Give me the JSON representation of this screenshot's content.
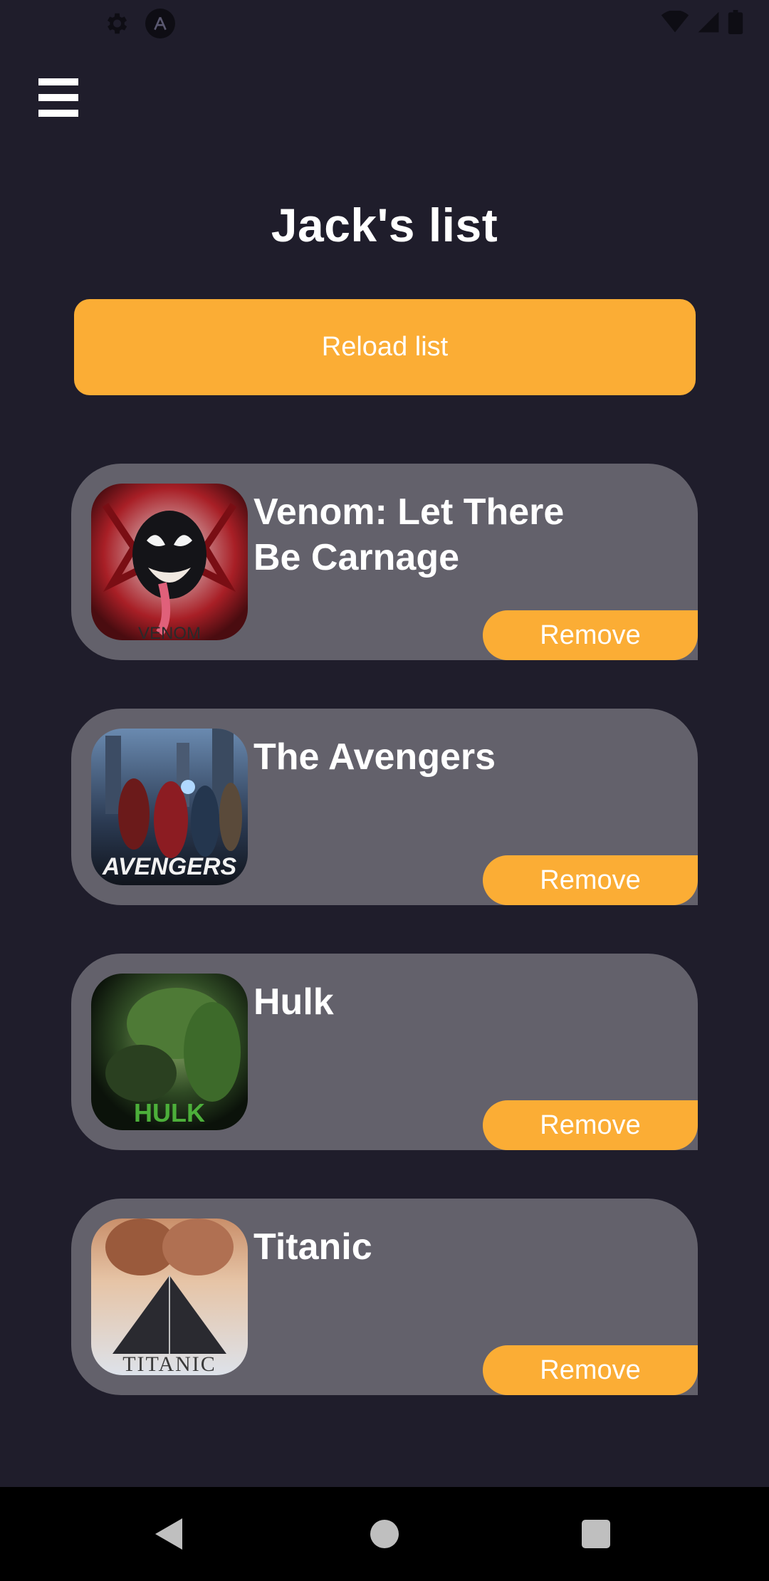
{
  "status_bar": {
    "left_icons": [
      "gear-icon",
      "auto-a-icon"
    ],
    "right_icons": [
      "wifi-icon",
      "cellular-signal-icon",
      "battery-icon"
    ]
  },
  "header": {
    "menu_icon": "hamburger-menu-icon",
    "title": "Jack's list"
  },
  "actions": {
    "reload_label": "Reload list"
  },
  "movies": [
    {
      "title": "Venom: Let There Be Carnage",
      "poster_text": "VENOM",
      "remove_label": "Remove"
    },
    {
      "title": "The Avengers",
      "poster_text": "AVENGERS",
      "remove_label": "Remove"
    },
    {
      "title": "Hulk",
      "poster_text": "HULK",
      "remove_label": "Remove"
    },
    {
      "title": "Titanic",
      "poster_text": "TITANIC",
      "remove_label": "Remove"
    }
  ],
  "nav_bar": {
    "buttons": [
      "back-icon",
      "home-icon",
      "recents-icon"
    ]
  },
  "colors": {
    "background": "#1f1d2b",
    "accent": "#fbad35",
    "card": "#63616b",
    "text": "#ffffff"
  }
}
